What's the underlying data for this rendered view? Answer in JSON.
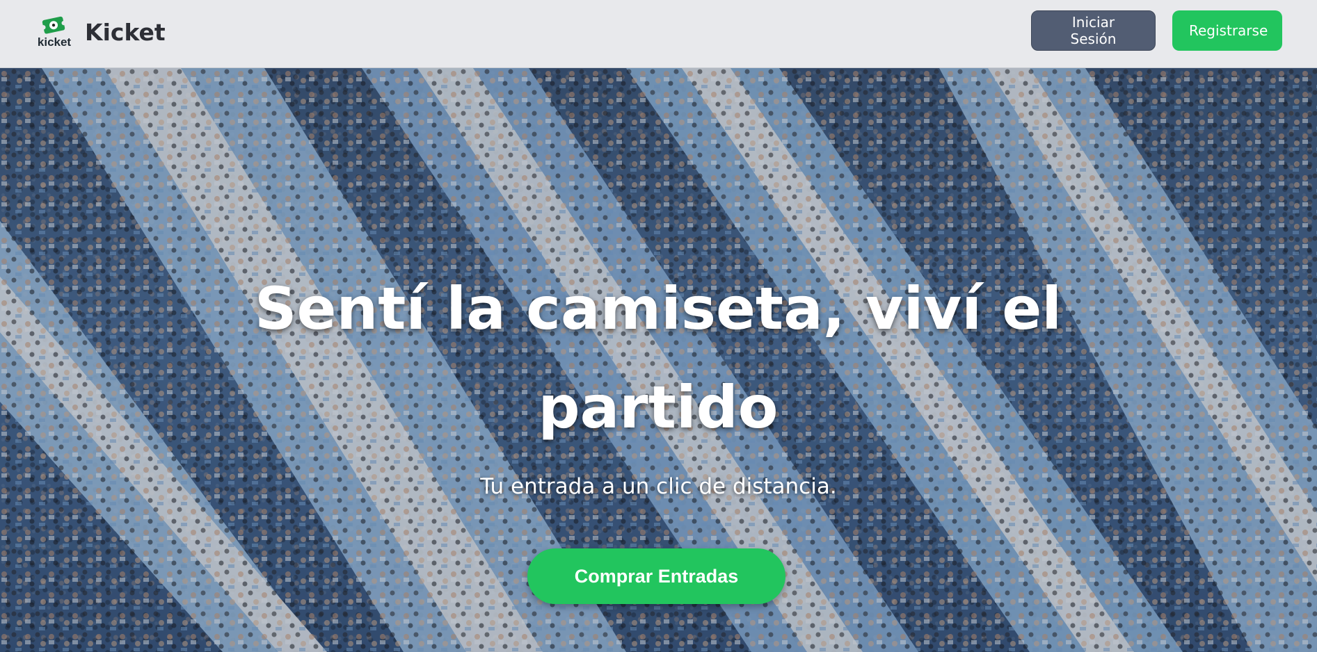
{
  "brand": {
    "logo_text": "kicket",
    "name": "Kicket"
  },
  "nav": {
    "login_label": "Iniciar Sesión",
    "register_label": "Registrarse"
  },
  "hero": {
    "title": "Sentí la camiseta, viví el partido",
    "subtitle": "Tu entrada a un clic de distancia.",
    "cta_label": "Comprar Entradas",
    "background": "stadium-crowd-flags-image"
  },
  "colors": {
    "accent_green": "#22c55e",
    "login_button": "#525d73",
    "navbar_bg": "#e8e9ec"
  }
}
